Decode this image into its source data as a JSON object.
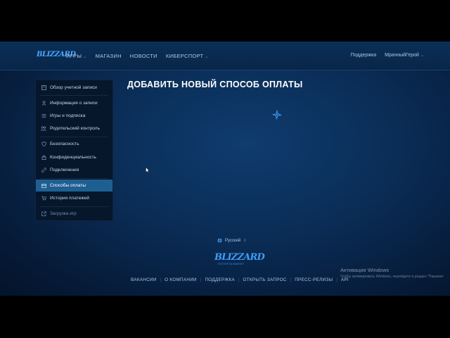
{
  "header": {
    "logo": "BLIZZARD",
    "nav": [
      {
        "label": "ИГРЫ",
        "dropdown": true
      },
      {
        "label": "МАГАЗИН",
        "dropdown": false
      },
      {
        "label": "НОВОСТИ",
        "dropdown": false
      },
      {
        "label": "КИБЕРСПОРТ",
        "dropdown": true
      }
    ],
    "support": "Поддержка",
    "user": "МрачныйГерой",
    "chevron": "⌄"
  },
  "sidebar": {
    "items": [
      {
        "label": "Обзор учетной записи",
        "icon": "overview-icon"
      },
      {
        "label": "Информация о записи",
        "icon": "user-icon"
      },
      {
        "label": "Игры и подписка",
        "icon": "list-icon"
      },
      {
        "label": "Родительский контроль",
        "icon": "parents-icon"
      },
      {
        "label": "Безопасность",
        "icon": "shield-icon"
      },
      {
        "label": "Конфиденциальность",
        "icon": "lock-icon"
      },
      {
        "label": "Подключения",
        "icon": "link-icon"
      },
      {
        "label": "Способы оплаты",
        "icon": "card-icon",
        "active": true
      },
      {
        "label": "История платежей",
        "icon": "cart-icon"
      },
      {
        "label": "Загрузка игр",
        "icon": "download-icon",
        "muted": true
      }
    ]
  },
  "main": {
    "title": "ДОБАВИТЬ НОВЫЙ СПОСОБ ОПЛАТЫ"
  },
  "footer": {
    "language": "Русский",
    "language_chevron": "⇕",
    "logo": "BLIZZARD",
    "logo_sub": "ENTERTAINMENT",
    "links": [
      "ВАКАНСИИ",
      "О КОМПАНИИ",
      "ПОДДЕРЖКА",
      "ОТКРЫТЬ ЗАПРОС",
      "ПРЕСС-РЕЛИЗЫ",
      "API"
    ],
    "separator": "|"
  },
  "activation": {
    "title": "Активация Windows",
    "subtitle": "Чтобы активировать Windows, перейдите в раздел \"Парамет"
  },
  "colors": {
    "accent": "#1e5f92",
    "brand": "#3f9cf5",
    "background": "#0a2c55"
  }
}
